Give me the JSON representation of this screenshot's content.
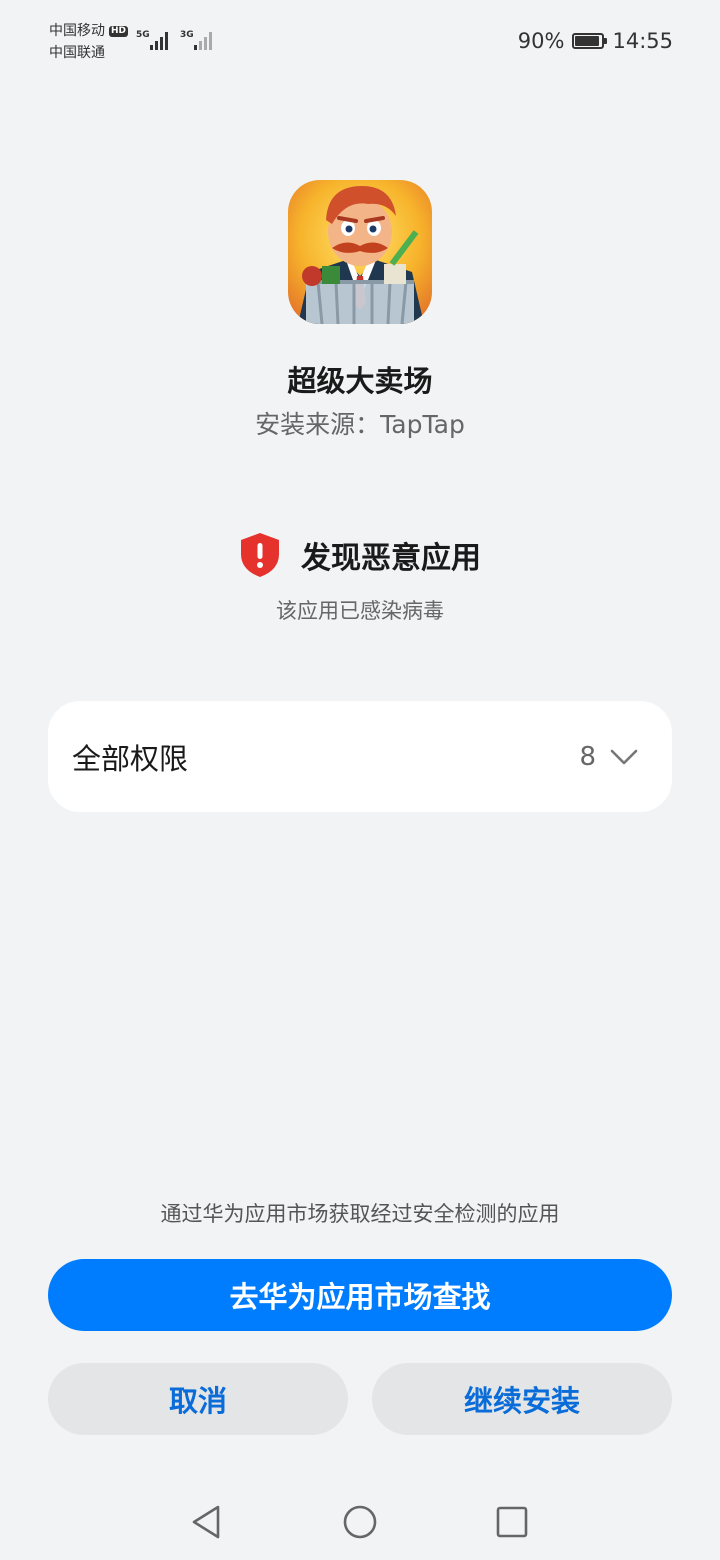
{
  "status_bar": {
    "carrier1": "中国移动",
    "carrier1_badge": "HD",
    "carrier2": "中国联通",
    "signal1_tech": "5G",
    "signal2_tech": "3G",
    "battery_percent_text": "90%",
    "battery_level": 0.9,
    "time": "14:55"
  },
  "app": {
    "icon": "supermarket-game-app-icon",
    "name": "超级大卖场",
    "install_source": "安装来源：TapTap"
  },
  "warning": {
    "icon": "shield-alert-icon",
    "title": "发现恶意应用",
    "subtitle": "该应用已感染病毒",
    "color": "#e5322d"
  },
  "permissions": {
    "label": "全部权限",
    "count": "8",
    "expand_icon": "chevron-down-icon"
  },
  "hint": "通过华为应用市场获取经过安全检测的应用",
  "buttons": {
    "primary": "去华为应用市场查找",
    "cancel": "取消",
    "continue": "继续安装"
  },
  "colors": {
    "primary": "#007dff",
    "secondary_text": "#0a6cd8",
    "background": "#f1f3f5"
  },
  "nav": {
    "back": "back-triangle-icon",
    "home": "home-circle-icon",
    "recents": "recents-square-icon"
  }
}
